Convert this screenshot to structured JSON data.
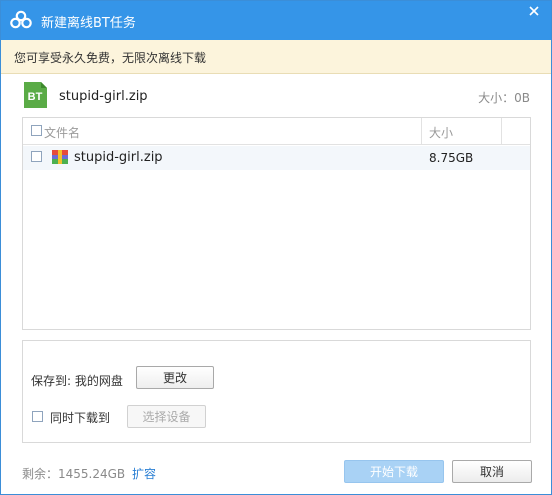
{
  "window": {
    "title": "新建离线BT任务",
    "accent_color": "#3595e8"
  },
  "notice": {
    "text": "您可享受永久免费，无限次离线下载"
  },
  "torrent": {
    "icon_text": "BT",
    "icon_color": "#5aab46",
    "name": "stupid-girl.zip",
    "total_size": "大小：0B"
  },
  "file_list": {
    "columns": [
      "文件名",
      "大小"
    ],
    "rows": [
      {
        "name": "stupid-girl.zip",
        "size": "8.75GB",
        "checked": false
      }
    ]
  },
  "save": {
    "label": "保存到: 我的网盘",
    "change_button": "更改",
    "sync_label": "同时下载到",
    "sync_checked": false,
    "device_button": "选择设备"
  },
  "footer": {
    "remaining": "剩余：1455.24GB",
    "expand_link": "扩容",
    "start_button": "开始下载",
    "cancel_button": "取消"
  }
}
